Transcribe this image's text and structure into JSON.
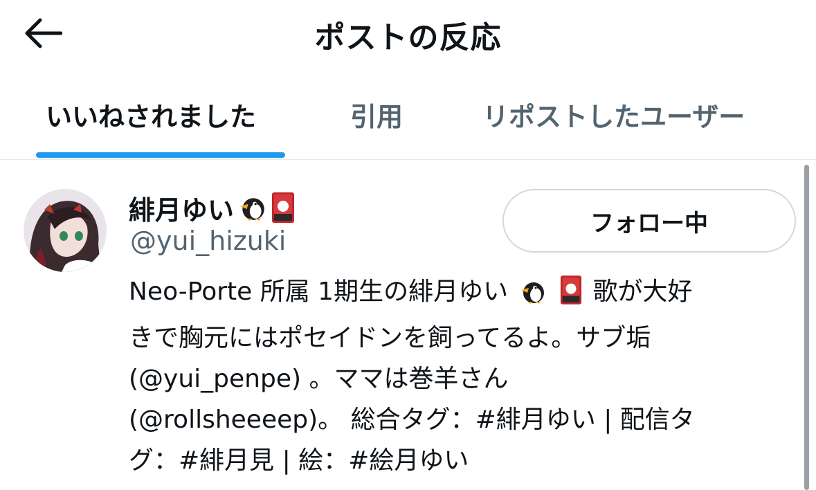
{
  "header": {
    "title": "ポストの反応"
  },
  "tabs": [
    {
      "label": "いいねされました",
      "active": true
    },
    {
      "label": "引用",
      "active": false
    },
    {
      "label": "リポストしたユーザー",
      "active": false
    }
  ],
  "colors": {
    "accent": "#1d9bf0",
    "text_primary": "#0f1419",
    "text_secondary": "#536471",
    "border": "#cfd9de"
  },
  "user": {
    "display_name": "緋月ゆい",
    "name_emojis": [
      "penguin-icon",
      "hanafuda-icon"
    ],
    "handle": "@yui_hizuki",
    "follow_button_label": "フォロー中",
    "bio": {
      "line1_a": "Neo-Porte 所属 1期生の緋月ゆい",
      "line1_b": "歌が大好",
      "line2": "きで胸元にはポセイドンを飼ってるよ。サブ垢",
      "line3": "(@yui_penpe) 。ママは巻羊さん",
      "line4": "(@rollsheeeep)。 総合タグ：#緋月ゆい | 配信タ",
      "line5": "グ：#緋月見 | 絵：#絵月ゆい"
    }
  }
}
